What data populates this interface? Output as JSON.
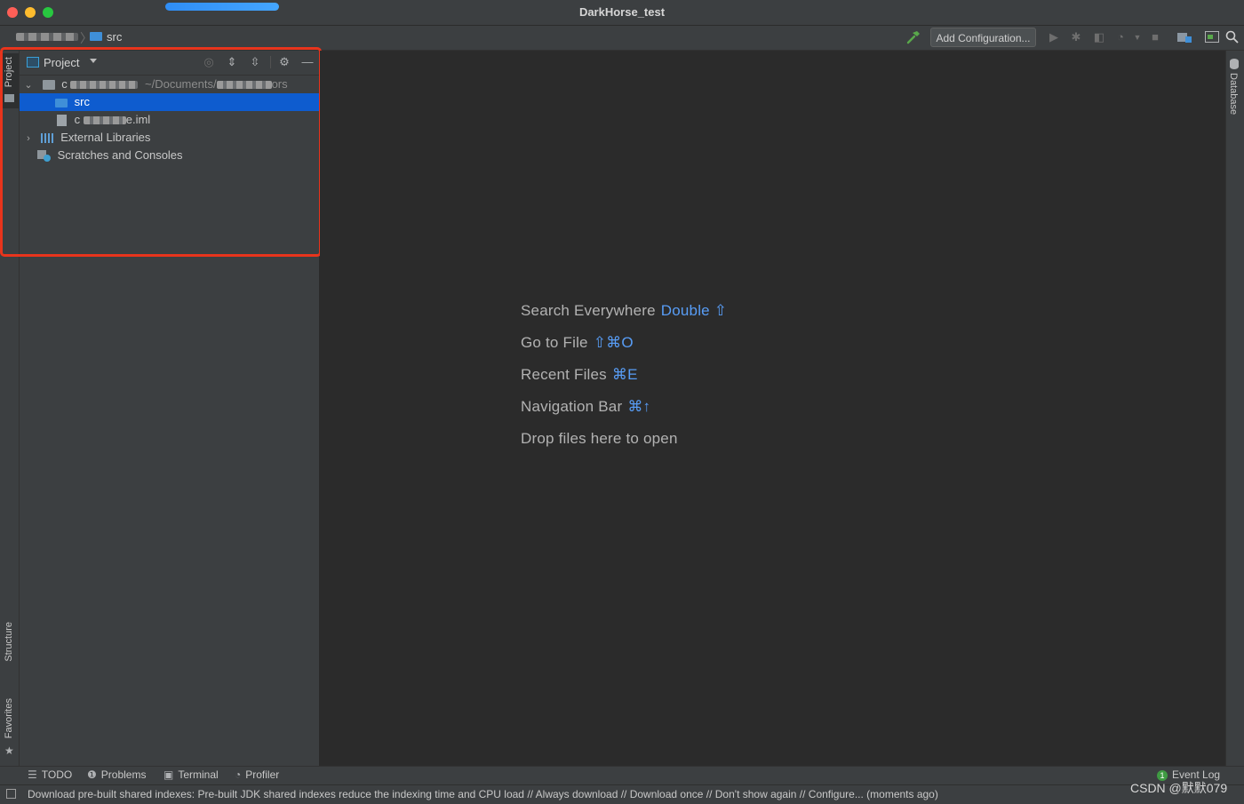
{
  "window": {
    "title": "DarkHorse_test"
  },
  "navbar": {
    "breadcrumb_current": "src",
    "separator": "〉",
    "add_configuration_label": "Add Configuration..."
  },
  "left_stripe": {
    "tabs": [
      "Project",
      "Structure",
      "Favorites"
    ]
  },
  "right_stripe": {
    "tabs": [
      "Database"
    ]
  },
  "project_panel": {
    "title": "Project",
    "tree": {
      "root_prefix": "c",
      "root_path": "~/Documents/",
      "root_path_tail": "ors",
      "src_label": "src",
      "iml_prefix": "c",
      "iml_suffix": "e.iml",
      "external_libraries": "External Libraries",
      "scratches": "Scratches and Consoles"
    }
  },
  "editor_hints": [
    {
      "label": "Search Everywhere",
      "key": "Double ⇧"
    },
    {
      "label": "Go to File",
      "key": "⇧⌘O"
    },
    {
      "label": "Recent Files",
      "key": "⌘E"
    },
    {
      "label": "Navigation Bar",
      "key": "⌘↑"
    },
    {
      "label": "Drop files here to open",
      "key": ""
    }
  ],
  "bottom_tabs": {
    "todo": "TODO",
    "problems": "Problems",
    "terminal": "Terminal",
    "profiler": "Profiler",
    "event_log": "Event Log",
    "event_count": "1"
  },
  "status_bar": {
    "message": "Download pre-built shared indexes: Pre-built JDK shared indexes reduce the indexing time and CPU load // Always download // Download once // Don't show again // Configure... (moments ago)"
  },
  "watermark": "CSDN @默默079",
  "colors": {
    "accent_blue": "#589df6",
    "selection": "#0e5ccf",
    "highlight_red": "#e8341c"
  }
}
